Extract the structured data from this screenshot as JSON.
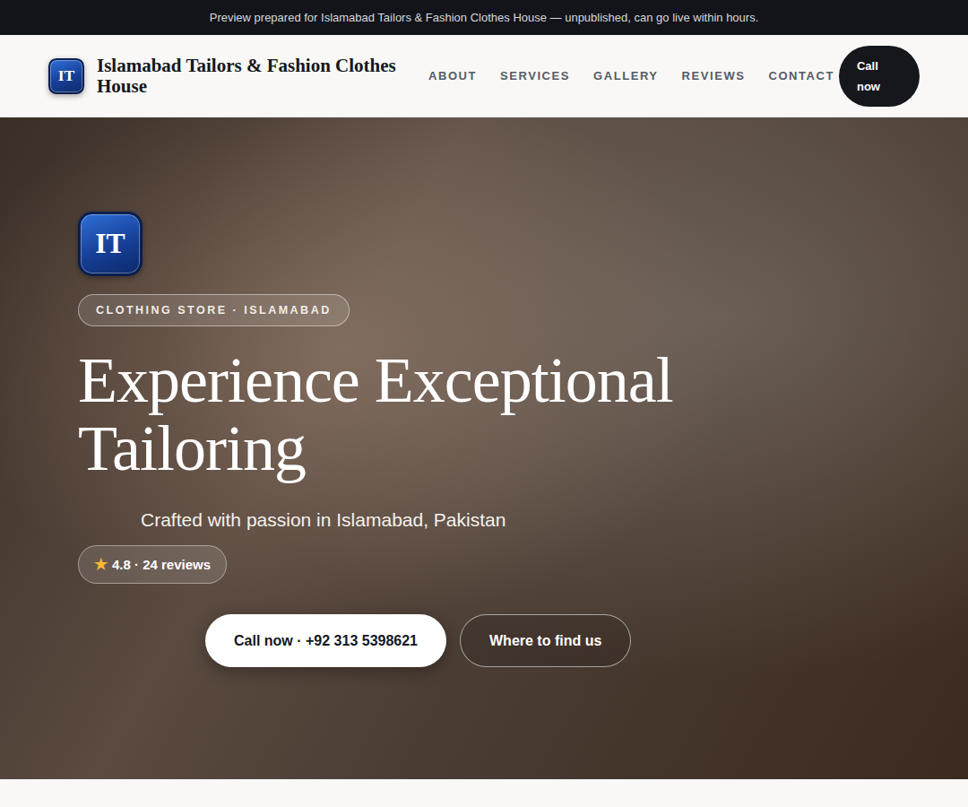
{
  "banner": {
    "text": "Preview prepared for Islamabad Tailors & Fashion Clothes House — unpublished, can go live within hours."
  },
  "header": {
    "logo": "IT",
    "brand": "Islamabad Tailors & Fashion Clothes House",
    "nav": [
      {
        "label": "ABOUT"
      },
      {
        "label": "SERVICES"
      },
      {
        "label": "GALLERY"
      },
      {
        "label": "REVIEWS"
      },
      {
        "label": "CONTACT"
      }
    ],
    "button": "Call now"
  },
  "hero": {
    "logo": "IT",
    "badge": "CLOTHING STORE · ISLAMABAD",
    "headline": "Experience Exceptional Tailoring",
    "subtitle": "Crafted with passion in Islamabad, Pakistan",
    "rating": {
      "star": "★",
      "text": "4.8 · 24 reviews"
    },
    "buttons": [
      {
        "label": "Call now · +92 313 5398621",
        "kind": "primary"
      },
      {
        "label": "Where to find us",
        "kind": "outline"
      }
    ]
  }
}
